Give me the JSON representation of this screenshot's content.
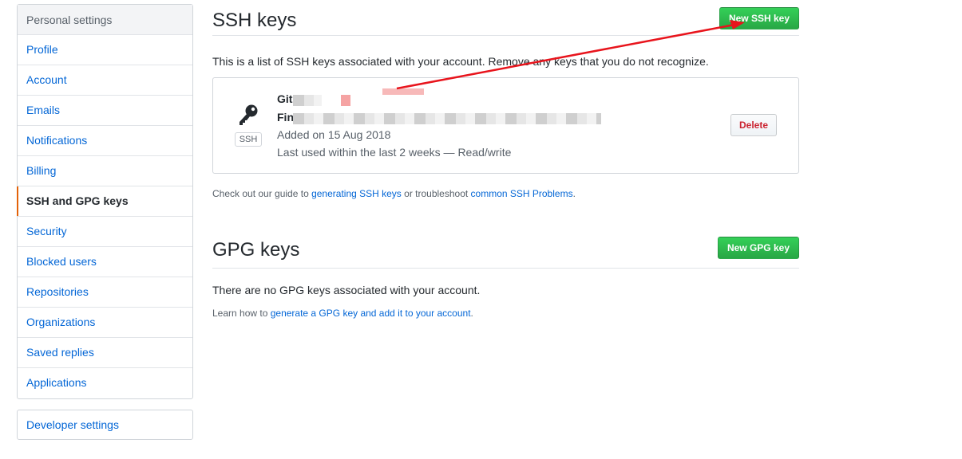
{
  "sidebar": {
    "header": "Personal settings",
    "items": [
      {
        "label": "Profile"
      },
      {
        "label": "Account"
      },
      {
        "label": "Emails"
      },
      {
        "label": "Notifications"
      },
      {
        "label": "Billing"
      },
      {
        "label": "SSH and GPG keys",
        "selected": true
      },
      {
        "label": "Security"
      },
      {
        "label": "Blocked users"
      },
      {
        "label": "Repositories"
      },
      {
        "label": "Organizations"
      },
      {
        "label": "Saved replies"
      },
      {
        "label": "Applications"
      }
    ],
    "developer_settings": "Developer settings"
  },
  "ssh": {
    "title": "SSH keys",
    "new_button": "New SSH key",
    "description": "This is a list of SSH keys associated with your account. Remove any keys that you do not recognize.",
    "key": {
      "type_badge": "SSH",
      "title_prefix": "Git",
      "fingerprint_prefix": "Fin",
      "added": "Added on 15 Aug 2018",
      "last_used": "Last used within the last 2 weeks — Read/write",
      "delete_button": "Delete"
    },
    "guide_prefix": "Check out our guide to ",
    "guide_link": "generating SSH keys",
    "guide_middle": " or troubleshoot ",
    "guide_link2": "common SSH Problems",
    "guide_suffix": "."
  },
  "gpg": {
    "title": "GPG keys",
    "new_button": "New GPG key",
    "empty_text": "There are no GPG keys associated with your account.",
    "learn_prefix": "Learn how to ",
    "learn_link": "generate a GPG key and add it to your account",
    "learn_suffix": "."
  },
  "colors": {
    "accent_selected": "#e36209",
    "link": "#0366d6",
    "green_button": "#28a745",
    "delete_text": "#cb2431",
    "annotation_arrow": "#e8141c"
  }
}
